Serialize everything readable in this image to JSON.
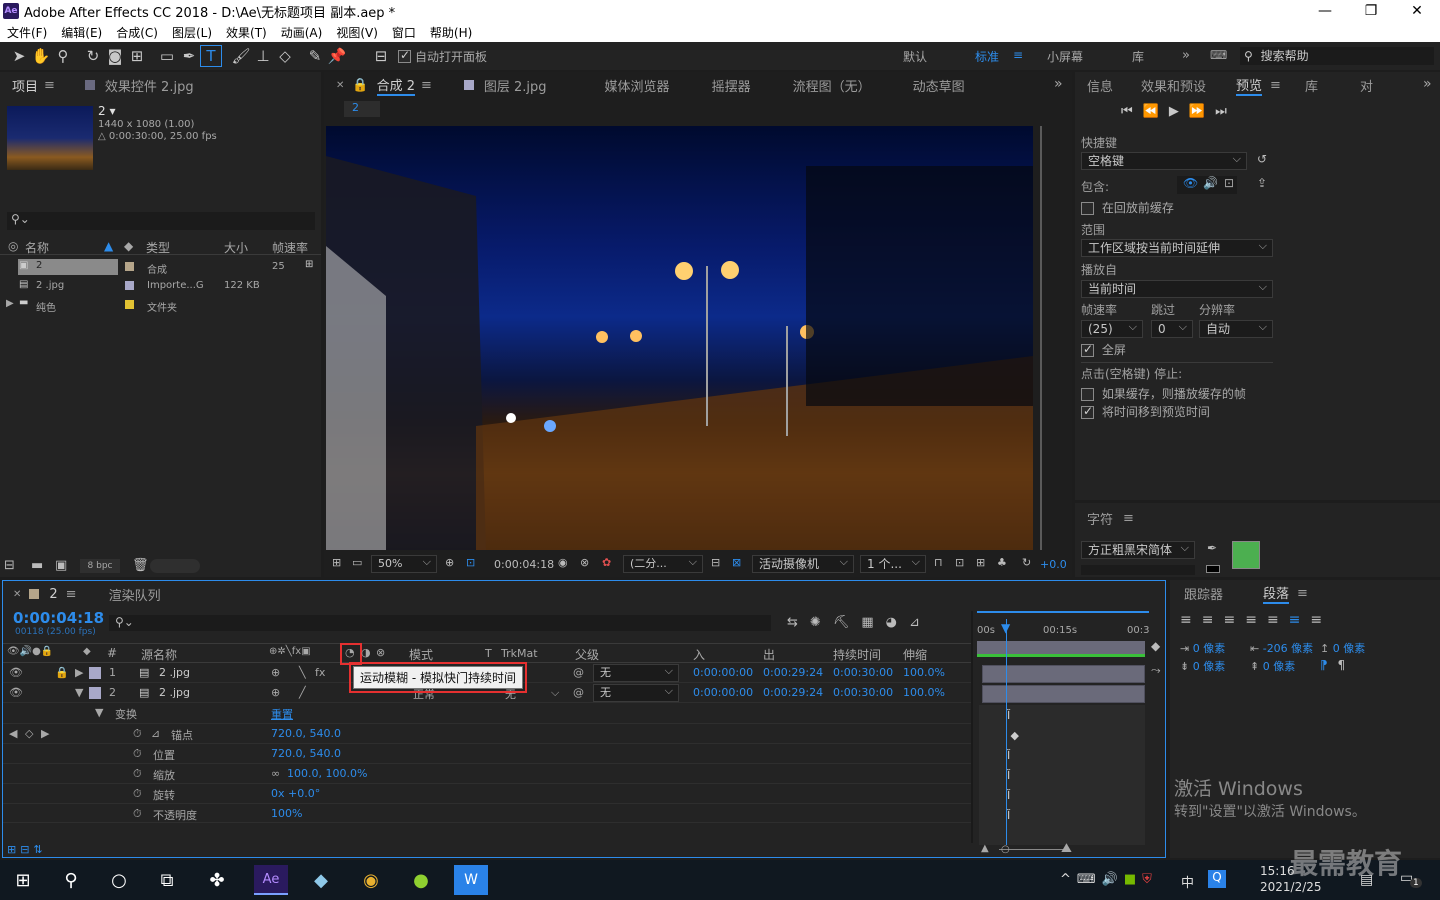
{
  "app": {
    "logo": "Ae",
    "title": "Adobe After Effects CC 2018 - D:\\Ae\\无标题项目 副本.aep *",
    "minimize": "—",
    "maximize": "❐",
    "close": "✕"
  },
  "menu": [
    "文件(F)",
    "编辑(E)",
    "合成(C)",
    "图层(L)",
    "效果(T)",
    "动画(A)",
    "视图(V)",
    "窗口",
    "帮助(H)"
  ],
  "toolbar": {
    "auto_open": "自动打开面板",
    "workspaces": [
      "默认",
      "标准",
      "小屏幕",
      "库"
    ],
    "active_workspace": "标准",
    "search_help": "搜索帮助"
  },
  "project": {
    "tabs": [
      "项目",
      "效果控件 2.jpg"
    ],
    "selected_name": "2 ▾",
    "selected_info1": "1440 x 1080 (1.00)",
    "selected_info2": "△ 0:00:30:00, 25.00 fps",
    "search_placeholder": "",
    "columns": [
      "名称",
      "类型",
      "大小",
      "帧速率"
    ],
    "items": [
      {
        "name": "2",
        "type": "合成",
        "size": "",
        "fps": "25",
        "color": "#b5a58a"
      },
      {
        "name": "2 .jpg",
        "type": "Importe...G",
        "size": "122 KB",
        "fps": "",
        "color": "#a8a8c8"
      },
      {
        "name": "纯色",
        "type": "文件夹",
        "size": "",
        "fps": "",
        "color": "#e2c233"
      }
    ],
    "bpc": "8 bpc"
  },
  "viewer": {
    "tabs": [
      "合成 2",
      "图层 2.jpg",
      "媒体浏览器",
      "摇摆器",
      "流程图（无）",
      "动态草图"
    ],
    "comp_label": "2",
    "zoom": "50%",
    "timecode": "0:00:04:18",
    "resolution": "(二分...",
    "camera": "活动摄像机",
    "views": "1 个...",
    "exposure": "+0.0"
  },
  "preview": {
    "tabs": [
      "信息",
      "效果和预设",
      "预览",
      "库",
      "对"
    ],
    "shortcut_label": "快捷键",
    "shortcut_value": "空格键",
    "include_label": "包含:",
    "cache_before": "在回放前缓存",
    "range_label": "范围",
    "range_value": "工作区域按当前时间延伸",
    "play_from_label": "播放自",
    "play_from_value": "当前时间",
    "fps_label": "帧速率",
    "skip_label": "跳过",
    "res_label": "分辨率",
    "fps_value": "(25)",
    "skip_value": "0",
    "res_value": "自动",
    "fullscreen": "全屏",
    "stop_label": "点击(空格键) 停止:",
    "opt1": "如果缓存，则播放缓存的帧",
    "opt2": "将时间移到预览时间"
  },
  "character": {
    "tab": "字符",
    "font": "方正粗黑宋简体",
    "fill_color": "#4caf50"
  },
  "paragraph": {
    "tabs": [
      "跟踪器",
      "段落"
    ],
    "v1": "0 像素",
    "v2": "-206 像素",
    "v3": "0 像素",
    "v4": "0 像素",
    "v5": "0 像素"
  },
  "timeline": {
    "tabs": [
      "2",
      "渲染队列"
    ],
    "timecode": "0:00:04:18",
    "timecode_sub": "00118 (25.00 fps)",
    "columns": {
      "num": "#",
      "source": "源名称",
      "mode": "模式",
      "t": "T",
      "trkmat": "TrkMat",
      "parent": "父级",
      "in": "入",
      "out": "出",
      "duration": "持续时间",
      "stretch": "伸缩"
    },
    "ruler": [
      "00s",
      "00:15s",
      "00:3"
    ],
    "tooltip": "运动模糊 - 模拟快门持续时间",
    "layers": [
      {
        "num": "1",
        "name": "2 .jpg",
        "mode": "正常",
        "trk": "无",
        "parent": "无",
        "in": "0:00:00:00",
        "out": "0:00:29:24",
        "dur": "0:00:30:00",
        "stretch": "100.0%"
      },
      {
        "num": "2",
        "name": "2 .jpg",
        "mode": "正常",
        "trk": "无",
        "parent": "无",
        "in": "0:00:00:00",
        "out": "0:00:29:24",
        "dur": "0:00:30:00",
        "stretch": "100.0%"
      }
    ],
    "transform": {
      "label": "变换",
      "reset": "重置"
    },
    "props": [
      {
        "name": "锚点",
        "value": "720.0, 540.0"
      },
      {
        "name": "位置",
        "value": "720.0, 540.0"
      },
      {
        "name": "缩放",
        "value": "100.0, 100.0%"
      },
      {
        "name": "旋转",
        "value": "0x +0.0°"
      },
      {
        "name": "不透明度",
        "value": "100%"
      }
    ]
  },
  "activation": {
    "line1": "激活 Windows",
    "line2": "转到\"设置\"以激活 Windows。"
  },
  "watermark": "最需教育",
  "taskbar": {
    "time": "15:16",
    "date": "2021/2/25",
    "ime": "中",
    "notif": "1"
  }
}
